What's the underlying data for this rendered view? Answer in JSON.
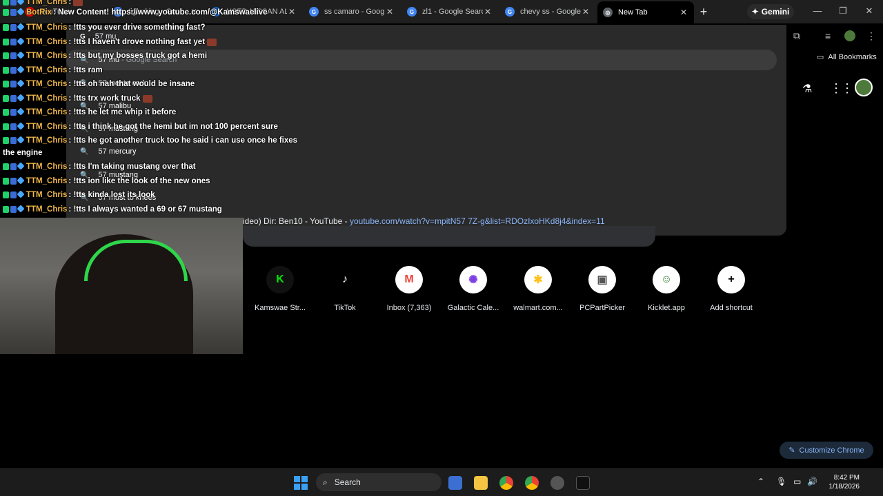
{
  "tabs": [
    {
      "title": "YouTube",
      "close": "✕"
    },
    {
      "title": "tiger king - Goo",
      "close": "✕"
    },
    {
      "title": "USED NISSAN ALTI",
      "close": "✕"
    },
    {
      "title": "ss camaro - Googl",
      "close": "✕"
    },
    {
      "title": "zl1 - Google Search",
      "close": "✕"
    },
    {
      "title": "chevy ss - Google S",
      "close": "✕"
    },
    {
      "title": "New Tab",
      "close": "✕"
    }
  ],
  "gemini_label": "Gemini",
  "bookmarks_label": "All Bookmarks",
  "omnibox": {
    "typed": "57 mu",
    "suggestions": [
      {
        "prefix": "57 mu",
        "rest": " - Google Search"
      },
      {
        "prefix": "57 m",
        "rest": "onte carlo"
      },
      {
        "prefix": "57 m",
        "rest": "alibu"
      },
      {
        "prefix": "57 m",
        "rest": "ustang"
      },
      {
        "prefix": "57 m",
        "rest": "ercury"
      },
      {
        "prefix": "57 mu",
        "rest": "stang"
      },
      {
        "prefix": "57 m",
        "rest": "ust to knees"
      }
    ],
    "yt_title": "ideo) Dir: Ben10 - YouTube - ",
    "yt_url": "youtube.com/watch?v=mpitN57 7Z-g&list=RDOzIxoHKd8j4&index=11"
  },
  "chat": [
    {
      "user": "TTM_Chris",
      "text": ": ",
      "emote": true
    },
    {
      "user": "BotRix",
      "text": ": New Content! https://www.youtube.com/@Kamswaelive",
      "emote": false
    },
    {
      "user": "TTM_Chris",
      "text": ": !tts you ever drive something fast?",
      "emote": false
    },
    {
      "user": "TTM_Chris",
      "text": ": !tts I haven't drove nothing fast yet",
      "emote": true
    },
    {
      "user": "TTM_Chris",
      "text": ": !tts but my bosses truck got a hemi",
      "emote": false
    },
    {
      "user": "TTM_Chris",
      "text": ": !tts ram",
      "emote": false
    },
    {
      "user": "TTM_Chris",
      "text": ": !tts oh nah that would be insane",
      "emote": false
    },
    {
      "user": "TTM_Chris",
      "text": ": !tts trx work truck",
      "emote": true
    },
    {
      "user": "TTM_Chris",
      "text": ": !tts he let me whip it before",
      "emote": false
    },
    {
      "user": "TTM_Chris",
      "text": ": !tts i think he got the hemi but im not 100 percent sure",
      "emote": false
    },
    {
      "user": "TTM_Chris",
      "text": ": !tts he got another truck too he said i can use once he fixes",
      "emote": false
    },
    {
      "user": "TTM_Chris",
      "text": ": !tts I'm taking mustang over that",
      "emote": false
    },
    {
      "user": "TTM_Chris",
      "text": ": !tts ion like the look of the new ones",
      "emote": false
    },
    {
      "user": "TTM_Chris",
      "text": ": !tts kinda lost its look",
      "emote": false
    },
    {
      "user": "TTM_Chris",
      "text": ": !tts I always wanted a 69 or 67 mustang",
      "emote": false
    }
  ],
  "chat_continuation": "the engine",
  "shortcuts": [
    {
      "label": "Kamswae Str...",
      "glyph": "K",
      "color": "#00e701",
      "bg": "#111"
    },
    {
      "label": "TikTok",
      "glyph": "♪",
      "color": "#fff",
      "bg": "#000"
    },
    {
      "label": "Inbox (7,363)",
      "glyph": "M",
      "color": "#ea4335",
      "bg": "#fff"
    },
    {
      "label": "Galactic Cale...",
      "glyph": "✺",
      "color": "#7b3fe4",
      "bg": "#fff"
    },
    {
      "label": "walmart.com...",
      "glyph": "✱",
      "color": "#ffc220",
      "bg": "#fff"
    },
    {
      "label": "PCPartPicker",
      "glyph": "▣",
      "color": "#555",
      "bg": "#fff"
    },
    {
      "label": "Kicklet.app",
      "glyph": "☺",
      "color": "#2e7d32",
      "bg": "#fff"
    },
    {
      "label": "Add shortcut",
      "glyph": "+",
      "color": "#000",
      "bg": "#fff"
    }
  ],
  "customize_label": "Customize Chrome",
  "taskbar": {
    "search_label": "Search",
    "time": "8:42 PM",
    "date": "1/18/2026"
  }
}
